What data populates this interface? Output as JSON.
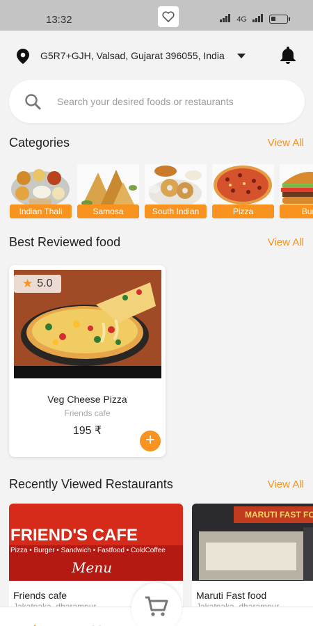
{
  "status": {
    "time": "13:32",
    "network": "4G"
  },
  "location": {
    "address": "G5R7+GJH, Valsad, Gujarat 396055, India"
  },
  "search": {
    "placeholder": "Search your desired foods or restaurants"
  },
  "categories_section": {
    "title": "Categories",
    "view_all": "View All",
    "items": [
      {
        "label": "Indian Thali"
      },
      {
        "label": "Samosa"
      },
      {
        "label": "South Indian"
      },
      {
        "label": "Pizza"
      },
      {
        "label": "Burg"
      }
    ]
  },
  "best_reviewed": {
    "title": "Best Reviewed food",
    "view_all": "View All",
    "item": {
      "rating": "5.0",
      "name": "Veg Cheese Pizza",
      "restaurant": "Friends cafe",
      "price": "195 ₹",
      "add_symbol": "+"
    }
  },
  "recent_restaurants": {
    "title": "Recently Viewed Restaurants",
    "view_all": "View All",
    "items": [
      {
        "name": "Friends cafe",
        "sub": "Jakatnaka, dharampur",
        "banner_text": "FRIEND'S CAFE",
        "banner_sub": "Pizza • Burger • Sandwich • Fastfood • ColdCoffee",
        "banner_menu": "Menu"
      },
      {
        "name": "Maruti Fast food",
        "sub": "Jakatnaka, dharampur",
        "banner_text": "MARUTI FAST FOOD"
      }
    ]
  },
  "colors": {
    "accent": "#f7931e",
    "background": "#f3f3f3"
  }
}
